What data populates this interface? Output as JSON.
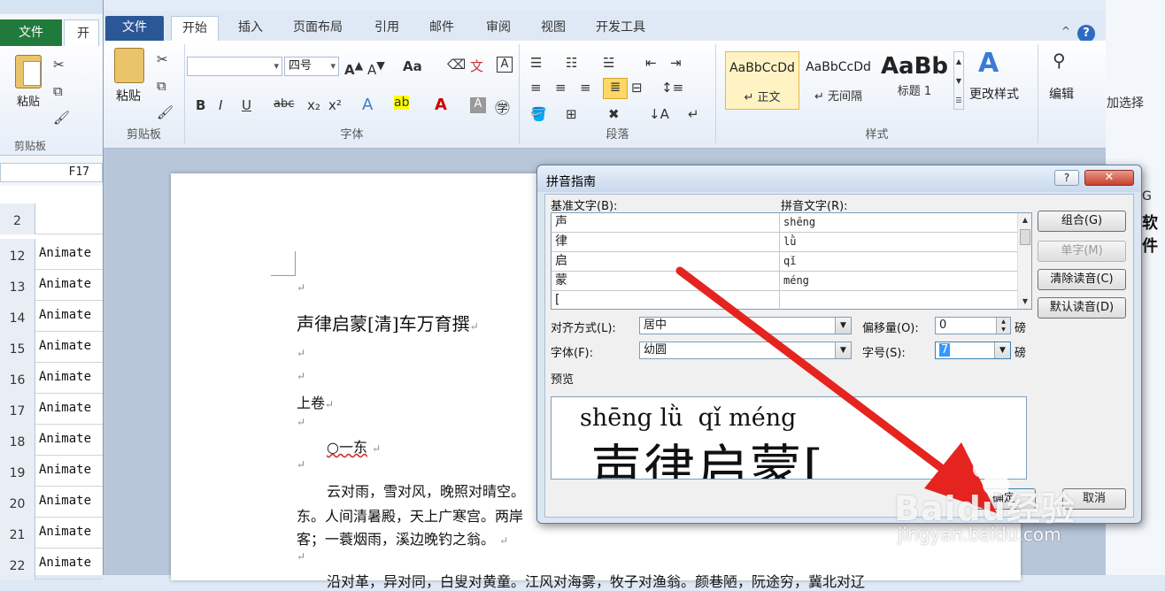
{
  "excel": {
    "file_tab": "文件",
    "home_tab": "开始",
    "paste_label": "粘贴",
    "clipboard_group": "剪贴板",
    "name_box": "F17",
    "rows": [
      {
        "num": "2",
        "value": ""
      },
      {
        "num": "12",
        "value": "Animate"
      },
      {
        "num": "13",
        "value": "Animate"
      },
      {
        "num": "14",
        "value": "Animate"
      },
      {
        "num": "15",
        "value": "Animate"
      },
      {
        "num": "16",
        "value": "Animate"
      },
      {
        "num": "17",
        "value": "Animate"
      },
      {
        "num": "18",
        "value": "Animate"
      },
      {
        "num": "19",
        "value": "Animate"
      },
      {
        "num": "20",
        "value": "Animate"
      },
      {
        "num": "21",
        "value": "Animate"
      },
      {
        "num": "22",
        "value": "Animate"
      }
    ],
    "right_partial_text": "加选择",
    "right_col_header": "G",
    "right_bold_text": "软件"
  },
  "word": {
    "tabs": [
      "文件",
      "开始",
      "插入",
      "页面布局",
      "引用",
      "邮件",
      "审阅",
      "视图",
      "开发工具"
    ],
    "paste_label": "粘贴",
    "clipboard_group": "剪贴板",
    "font_size": "四号",
    "font_group": "字体",
    "paragraph_group": "段落",
    "styles_group": "样式",
    "styles": [
      {
        "sample": "AaBbCcDd",
        "name": "↵ 正文"
      },
      {
        "sample": "AaBbCcDd",
        "name": "↵ 无间隔"
      },
      {
        "sample": "AaBb",
        "name": "标题 1"
      }
    ],
    "change_styles": "更改样式",
    "edit_label": "编辑",
    "doc_lines": {
      "title": "声律启蒙[清]车万育撰",
      "section": "上卷",
      "heading": "○一东",
      "p1": "云对雨，雪对风，晚照对晴空。",
      "p2": "东。人间清暑殿，天上广寒宫。两岸",
      "p3": "客；一蓑烟雨，溪边晚钓之翁。",
      "p4": "沿对革，异对同，白叟对黄童。江风对海雾，牧子对渔翁。颜巷陋，阮途穷，冀北对辽"
    }
  },
  "dialog": {
    "title": "拼音指南",
    "base_text_label": "基准文字(B):",
    "pinyin_text_label": "拼音文字(R):",
    "rows": [
      {
        "base": "声",
        "pinyin": "shēng"
      },
      {
        "base": "律",
        "pinyin": "lǜ"
      },
      {
        "base": "启",
        "pinyin": "qǐ"
      },
      {
        "base": "蒙",
        "pinyin": "méng"
      },
      {
        "base": "[",
        "pinyin": ""
      }
    ],
    "buttons": {
      "group": "组合(G)",
      "single": "单字(M)",
      "clear": "清除读音(C)",
      "default": "默认读音(D)",
      "ok": "确定",
      "cancel": "取消"
    },
    "align_label": "对齐方式(L):",
    "align_value": "居中",
    "offset_label": "偏移量(O):",
    "offset_value": "0",
    "offset_unit": "磅",
    "font_label": "字体(F):",
    "font_value": "幼圆",
    "size_label": "字号(S):",
    "size_value": "7",
    "size_unit": "磅",
    "preview_label": "预览",
    "preview_pinyin": "shēng lǜ  qǐ méng",
    "preview_hanzi": "声律启蒙["
  },
  "watermark": {
    "brand": "Baidu经验",
    "url": "jingyan.baidu.com"
  },
  "colors": {
    "arrow": "#e52420",
    "word_file_tab": "#2b5797",
    "excel_file_tab": "#1f7a3c"
  }
}
